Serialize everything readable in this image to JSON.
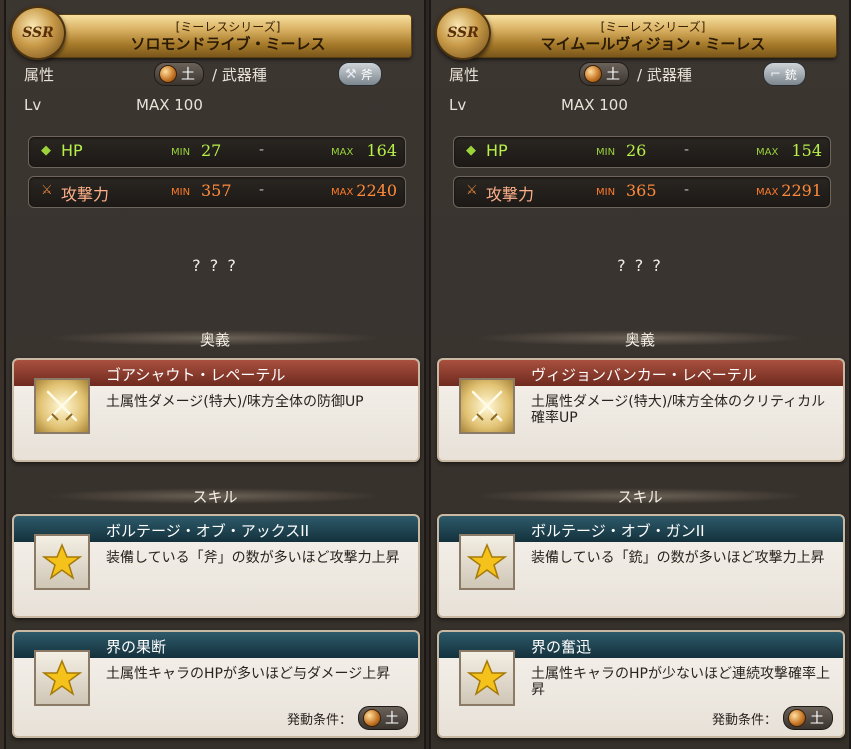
{
  "panels": [
    {
      "rarity": "SSR",
      "series": "[ミーレスシリーズ]",
      "name": "ソロモンドライブ・ミーレス",
      "attribute_label": "属性",
      "attribute": "土",
      "weapon_type_label": "/ 武器種",
      "weapon_type": "斧",
      "lv_label": "Lv",
      "lv_value": "MAX 100",
      "hp": {
        "label": "HP",
        "min_label": "MIN",
        "min": "27",
        "dash": "-",
        "max_label": "MAX",
        "max": "164"
      },
      "atk": {
        "label": "攻撃力",
        "min_label": "MIN",
        "min": "357",
        "dash": "-",
        "max_label": "MAX",
        "max": "2240"
      },
      "unknown": "? ? ?",
      "ougi_heading": "奥義",
      "ougi": {
        "name": "ゴアシャウト・レペーテル",
        "desc": "土属性ダメージ(特大)/味方全体の防御UP"
      },
      "skill_heading": "スキル",
      "skills": [
        {
          "name": "ボルテージ・オブ・アックスII",
          "desc": "装備している「斧」の数が多いほど攻撃力上昇"
        },
        {
          "name": "界の果断",
          "desc": "土属性キャラのHPが多いほど与ダメージ上昇",
          "cond_label": "発動条件：",
          "cond_attr": "土"
        }
      ]
    },
    {
      "rarity": "SSR",
      "series": "[ミーレスシリーズ]",
      "name": "マイムールヴィジョン・ミーレス",
      "attribute_label": "属性",
      "attribute": "土",
      "weapon_type_label": "/ 武器種",
      "weapon_type": "銃",
      "lv_label": "Lv",
      "lv_value": "MAX 100",
      "hp": {
        "label": "HP",
        "min_label": "MIN",
        "min": "26",
        "dash": "-",
        "max_label": "MAX",
        "max": "154"
      },
      "atk": {
        "label": "攻撃力",
        "min_label": "MIN",
        "min": "365",
        "dash": "-",
        "max_label": "MAX",
        "max": "2291"
      },
      "unknown": "? ? ?",
      "ougi_heading": "奥義",
      "ougi": {
        "name": "ヴィジョンバンカー・レペーテル",
        "desc": "土属性ダメージ(特大)/味方全体のクリティカル確率UP"
      },
      "skill_heading": "スキル",
      "skills": [
        {
          "name": "ボルテージ・オブ・ガンII",
          "desc": "装備している「銃」の数が多いほど攻撃力上昇"
        },
        {
          "name": "界の奮迅",
          "desc": "土属性キャラのHPが少ないほど連続攻撃確率上昇",
          "cond_label": "発動条件：",
          "cond_attr": "土"
        }
      ]
    }
  ],
  "icons": {
    "hp": "diamond-icon",
    "atk": "sword-icon",
    "ougi": "crossed-swords-icon",
    "skill": "star-icon",
    "axe": "axe-icon",
    "gun": "gun-icon"
  },
  "colors": {
    "hp": "#b8f04a",
    "atk": "#ff8a3a",
    "ougi_header": "#8a3a2c",
    "skill_header": "#1f4452",
    "gold": "#d9b062"
  }
}
